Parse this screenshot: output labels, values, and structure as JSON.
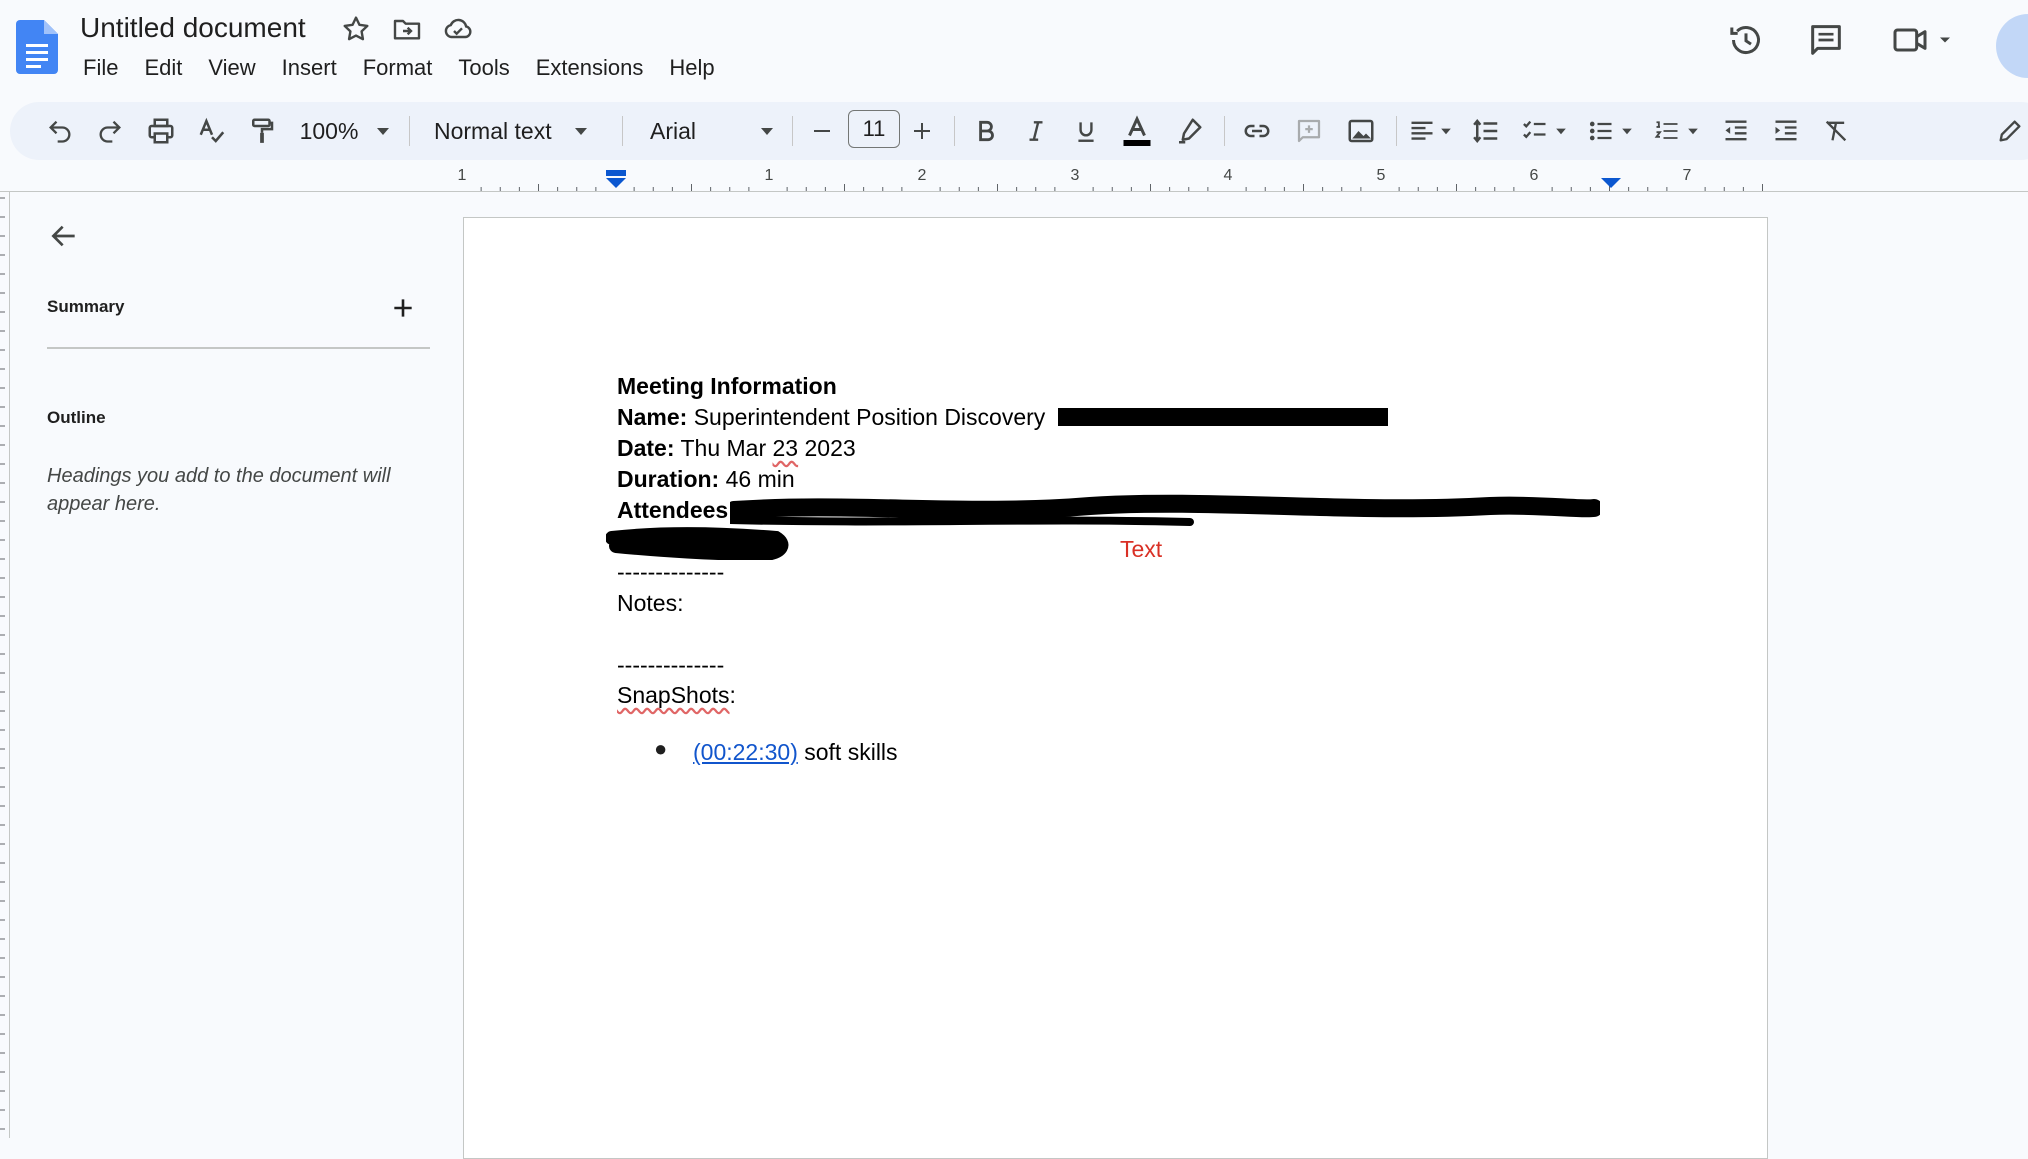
{
  "app": {
    "title": "Untitled document",
    "menu": [
      "File",
      "Edit",
      "View",
      "Insert",
      "Format",
      "Tools",
      "Extensions",
      "Help"
    ]
  },
  "icons": {
    "logo": "docs-logo-icon",
    "title_actions": [
      "star-icon",
      "move-folder-icon",
      "cloud-status-icon"
    ],
    "top_right": [
      "version-history-icon",
      "comments-icon",
      "meet-video-icon"
    ]
  },
  "toolbar": {
    "zoom": "100%",
    "style": "Normal text",
    "font": "Arial",
    "font_size": "11",
    "text_color": "#000000"
  },
  "ruler": {
    "labels": [
      "1",
      "1",
      "2",
      "3",
      "4",
      "5",
      "6",
      "7"
    ]
  },
  "sidebar": {
    "summary_label": "Summary",
    "outline_label": "Outline",
    "outline_hint": "Headings you add to the document will appear here."
  },
  "document": {
    "heading": "Meeting Information",
    "name_label": "Name:",
    "name_value": " Superintendent Position Discovery",
    "date_label": "Date:",
    "date_value_a": " Thu Mar ",
    "date_value_b": "23",
    "date_value_c": " 2023",
    "duration_label": "Duration:",
    "duration_value": " 46 min",
    "attendees_label": "Attendees:",
    "divider": "--------------",
    "notes_label": "Notes:",
    "snapshots_word": "SnapShots",
    "snapshots_colon": ":",
    "bullet": "●",
    "timestamp": "(00:22:30)",
    "snapshot_text": " soft skills",
    "annotation": "Text"
  },
  "colors": {
    "accent": "#0b57d0",
    "annotation": "#d93025",
    "link": "#1155cc",
    "toolbar_bg": "#edf2fa"
  }
}
